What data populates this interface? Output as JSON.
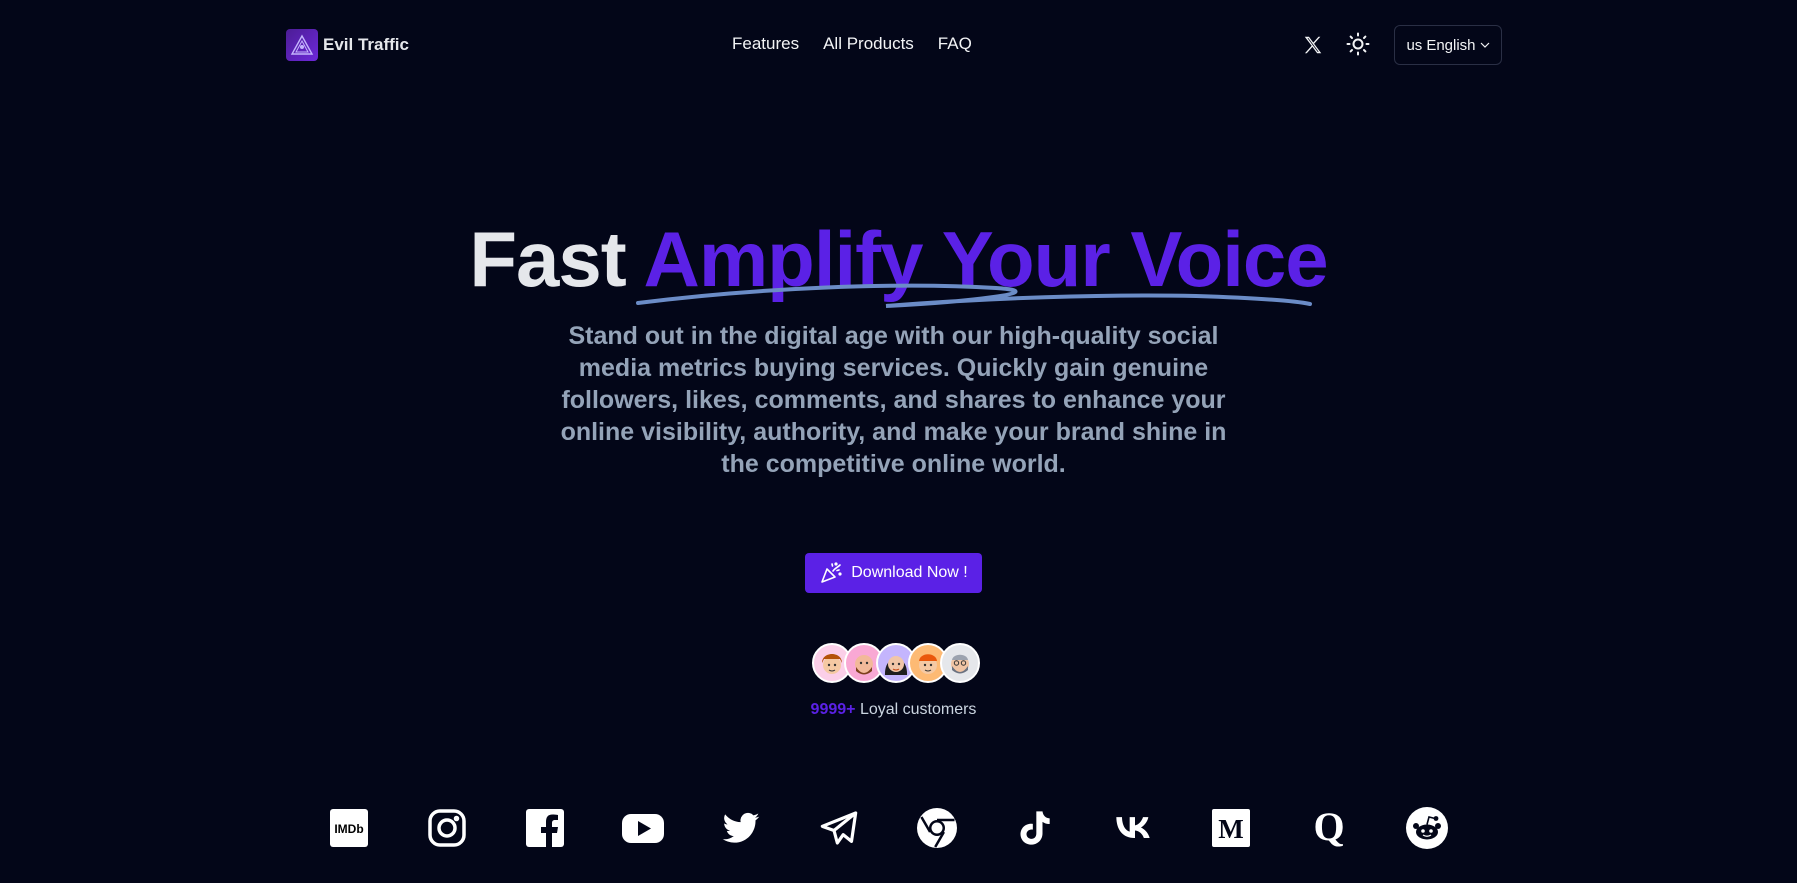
{
  "header": {
    "brand_name": "Evil Traffic",
    "nav": [
      {
        "label": "Features"
      },
      {
        "label": "All Products"
      },
      {
        "label": "FAQ"
      }
    ],
    "language": {
      "flag": "us",
      "label": "English"
    }
  },
  "hero": {
    "title_plain": "Fast",
    "title_accent": "Amplify Your Voice",
    "subtitle": "Stand out in the digital age with our high-quality social media metrics buying services. Quickly gain genuine followers, likes, comments, and shares to enhance your online visibility, authority, and make your brand shine in the competitive online world.",
    "cta_label": "Download Now !",
    "customers_count": "9999+",
    "customers_label": "Loyal customers"
  },
  "platforms": [
    {
      "name": "imdb-icon",
      "label": "IMDb"
    },
    {
      "name": "instagram-icon"
    },
    {
      "name": "facebook-icon"
    },
    {
      "name": "youtube-icon"
    },
    {
      "name": "twitter-icon"
    },
    {
      "name": "telegram-icon"
    },
    {
      "name": "chrome-icon"
    },
    {
      "name": "tiktok-icon"
    },
    {
      "name": "vk-icon"
    },
    {
      "name": "medium-icon",
      "label": "M"
    },
    {
      "name": "quora-icon",
      "label": "Q"
    },
    {
      "name": "reddit-icon"
    }
  ],
  "colors": {
    "background": "#030618",
    "accent": "#5b21e6",
    "muted_text": "#94a3b8",
    "scribble": "#6b8cc7"
  }
}
